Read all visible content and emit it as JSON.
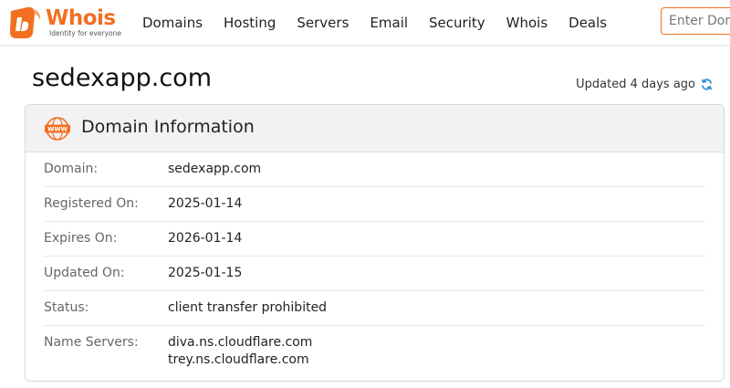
{
  "brand": {
    "name": "Whois",
    "tagline": "Identity for everyone",
    "accent": "#f26f21"
  },
  "nav": {
    "items": [
      "Domains",
      "Hosting",
      "Servers",
      "Email",
      "Security",
      "Whois",
      "Deals"
    ]
  },
  "search": {
    "placeholder": "Enter Domain"
  },
  "page": {
    "domain": "sedexapp.com",
    "updated": "Updated 4 days ago"
  },
  "card": {
    "title": "Domain Information",
    "icon_text": "WWW",
    "rows": [
      {
        "label": "Domain:",
        "values": [
          "sedexapp.com"
        ]
      },
      {
        "label": "Registered On:",
        "values": [
          "2025-01-14"
        ]
      },
      {
        "label": "Expires On:",
        "values": [
          "2026-01-14"
        ]
      },
      {
        "label": "Updated On:",
        "values": [
          "2025-01-15"
        ]
      },
      {
        "label": "Status:",
        "values": [
          "client transfer prohibited"
        ]
      },
      {
        "label": "Name Servers:",
        "values": [
          "diva.ns.cloudflare.com",
          "trey.ns.cloudflare.com"
        ]
      }
    ]
  }
}
